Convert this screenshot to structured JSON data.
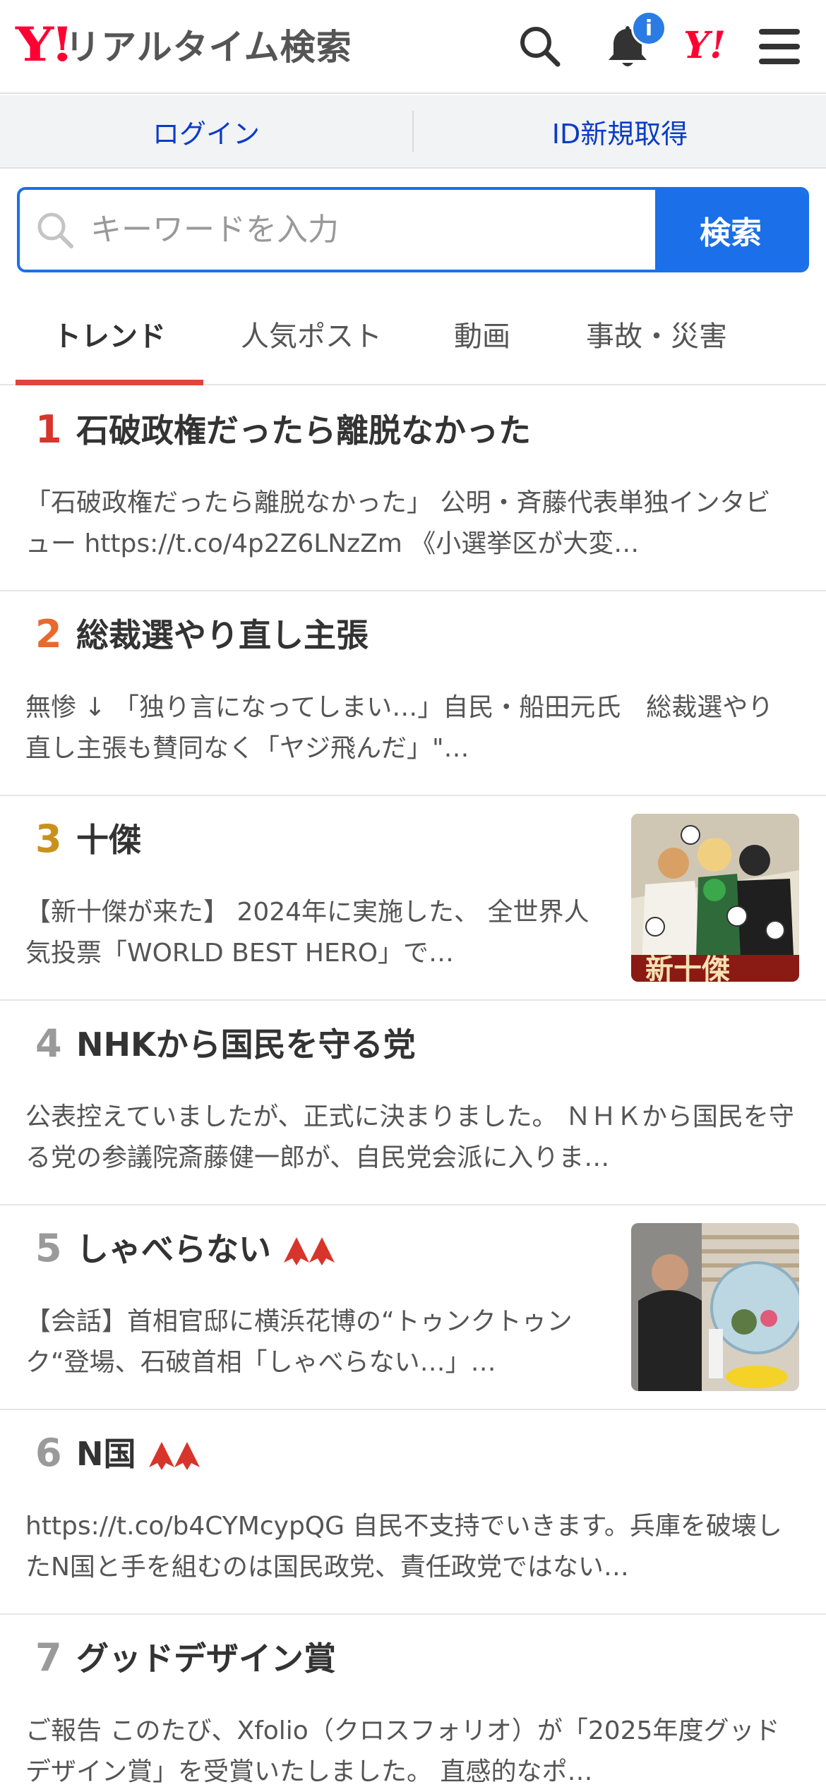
{
  "header": {
    "logo_mark": "Y!",
    "logo_text": "リアルタイム検索",
    "notification_badge": "i",
    "yahoo_mark": "Y!"
  },
  "account": {
    "login_label": "ログイン",
    "signup_label": "ID新規取得"
  },
  "search": {
    "placeholder": "キーワードを入力",
    "button_label": "検索"
  },
  "tabs": [
    {
      "label": "トレンド",
      "active": true
    },
    {
      "label": "人気ポスト",
      "active": false
    },
    {
      "label": "動画",
      "active": false
    },
    {
      "label": "事故・災害",
      "active": false
    }
  ],
  "trends": [
    {
      "rank": "1",
      "title": "石破政権だったら離脱なかった",
      "snippet": "「石破政権だったら離脱なかった」 公明・斉藤代表単独インタビュー https://t.co/4p2Z6LNzZm 《小選挙区が大変…",
      "rank_color": "#d7352b",
      "rising": false,
      "thumbnail": null
    },
    {
      "rank": "2",
      "title": "総裁選やり直し主張",
      "snippet": "無惨 ↓ 「独り言になってしまい…」自民・船田元氏　総裁選やり直し主張も賛同なく「ヤジ飛んだ」\"…",
      "rank_color": "#e8692e",
      "rising": false,
      "thumbnail": null
    },
    {
      "rank": "3",
      "title": "十傑",
      "snippet": "【新十傑が来た󠄀】 2024年に実施した、 全世界人気投票「WORLD BEST HERO」で…",
      "rank_color": "#c9911b",
      "rising": false,
      "thumbnail": "anime-poster"
    },
    {
      "rank": "4",
      "title": "NHKから国民を守る党",
      "snippet": "公表控えていましたが、正式に決まりました。 ＮＨＫから国民を守る党の参議院斎藤健一郎が、自民党会派に入りま…",
      "rank_color": "#9a9a9a",
      "rising": false,
      "thumbnail": null
    },
    {
      "rank": "5",
      "title": "しゃべらない",
      "snippet": "【会話】首相官邸に横浜花博の“トゥンクトゥンク“登場、石破首相「しゃべらない…」…",
      "rank_color": "#9a9a9a",
      "rising": true,
      "thumbnail": "photo"
    },
    {
      "rank": "6",
      "title": "N国",
      "snippet": "https://t.co/b4CYMcypQG 自民不支持でいきます。兵庫を破壊したN国と手を組むのは国民政党、責任政党ではない…",
      "rank_color": "#9a9a9a",
      "rising": true,
      "thumbnail": null
    },
    {
      "rank": "7",
      "title": "グッドデザイン賞",
      "snippet": "󠄀ご報告󠄀 このたび、Xfolio（クロスフォリオ）が「2025年度グッドデザイン賞」を受賞いたしました。 直感的なポ…",
      "rank_color": "#9a9a9a",
      "rising": false,
      "thumbnail": null
    }
  ],
  "icons": {
    "search": "search-icon",
    "bell": "bell-icon",
    "menu": "hamburger-menu-icon",
    "rising": "double-up-arrow-icon"
  }
}
